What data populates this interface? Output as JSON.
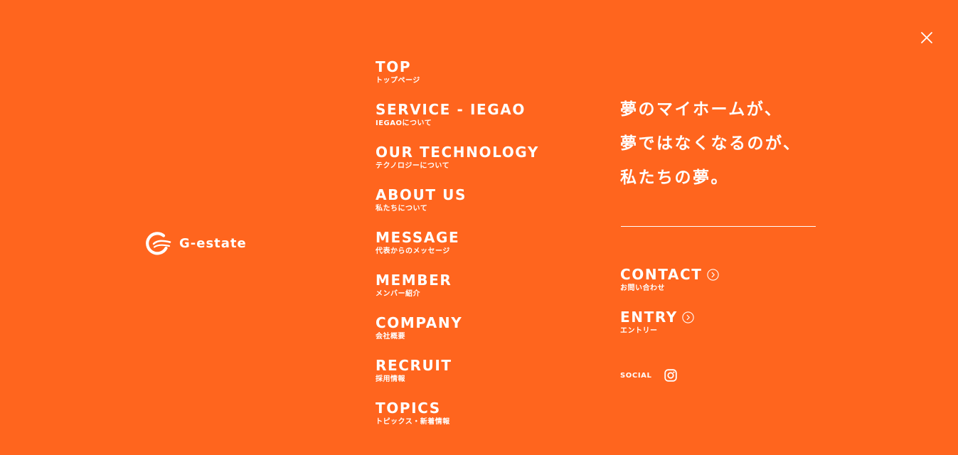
{
  "colors": {
    "background": "#FF651E",
    "foreground": "#FFFFFF"
  },
  "header": {
    "close_icon": "close-icon"
  },
  "brand": {
    "logo_icon": "g-estate-logo-mark",
    "name": "G-estate"
  },
  "nav": {
    "items": [
      {
        "en": "TOP",
        "ja": "トップページ"
      },
      {
        "en": "SERVICE - IEGAO",
        "ja": "IEGAOについて"
      },
      {
        "en": "OUR TECHNOLOGY",
        "ja": "テクノロジーについて"
      },
      {
        "en": "ABOUT US",
        "ja": "私たちについて"
      },
      {
        "en": "MESSAGE",
        "ja": "代表からのメッセージ"
      },
      {
        "en": "MEMBER",
        "ja": "メンバー紹介"
      },
      {
        "en": "COMPANY",
        "ja": "会社概要"
      },
      {
        "en": "RECRUIT",
        "ja": "採用情報"
      },
      {
        "en": "TOPICS",
        "ja": "トピックス・新着情報"
      }
    ]
  },
  "catch": {
    "lines": [
      "夢のマイホームが、",
      "夢ではなくなるのが、",
      "私たちの夢。"
    ]
  },
  "cta": {
    "contact": {
      "en": "CONTACT",
      "ja": "お問い合わせ",
      "icon": "circle-arrow-right-icon"
    },
    "entry": {
      "en": "ENTRY",
      "ja": "エントリー",
      "icon": "circle-arrow-right-icon"
    }
  },
  "social": {
    "label": "SOCIAL",
    "icon": "instagram-icon"
  }
}
